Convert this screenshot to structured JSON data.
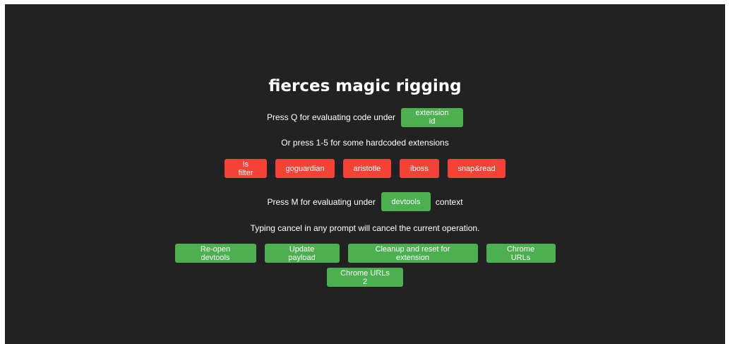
{
  "title": "fierces magic rigging",
  "line1": {
    "text": "Press Q for evaluating code under",
    "button": "extension id"
  },
  "line2": {
    "text": "Or press 1-5 for some hardcoded extensions"
  },
  "extensions": [
    {
      "label": "ls filter"
    },
    {
      "label": "goguardian"
    },
    {
      "label": "aristotle"
    },
    {
      "label": "iboss"
    },
    {
      "label": "snap&read"
    }
  ],
  "line3": {
    "text_before": "Press M for evaluating under",
    "button": "devtools",
    "text_after": "context"
  },
  "line4": {
    "text": "Typing cancel in any prompt will cancel the current operation."
  },
  "actions": [
    {
      "label": "Re-open devtools"
    },
    {
      "label": "Update payload"
    },
    {
      "label": "Cleanup and reset for extension"
    },
    {
      "label": "Chrome URLs"
    },
    {
      "label": "Chrome URLs 2"
    }
  ],
  "colors": {
    "background": "#222222",
    "primary_button": "#4caf50",
    "extension_button": "#f44336",
    "text": "#ffffff"
  }
}
